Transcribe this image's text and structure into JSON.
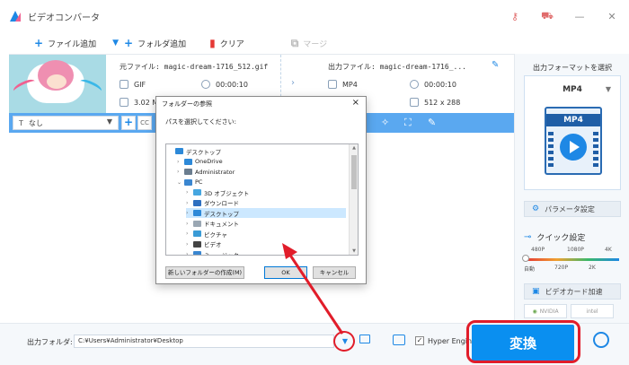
{
  "app": {
    "title": "ビデオコンバータ"
  },
  "toolbar": {
    "add_file": "ファイル追加",
    "add_folder": "フォルダ追加",
    "clear": "クリア",
    "merge": "マージ"
  },
  "file": {
    "source_name": "元ファイル: magic-dream-1716_512.gif",
    "source_format": "GIF",
    "source_duration": "00:00:10",
    "source_size": "3.02 M",
    "output_name": "出力ファイル: magic-dream-1716_...",
    "output_format": "MP4",
    "output_duration": "00:00:10",
    "output_resolution": "512 x 288"
  },
  "subtitle": {
    "select": "なし",
    "cc": "CC"
  },
  "right_panel": {
    "header": "出力フォーマットを選択",
    "format": "MP4",
    "format_icon_text": "MP4",
    "params": "パラメータ設定",
    "quick": "クイック設定",
    "ticks_top": [
      "480P",
      "1080P",
      "4K"
    ],
    "ticks_bottom": [
      "自動",
      "720P",
      "2K"
    ],
    "hw_accel": "ビデオカード加速",
    "gpu": [
      "NVIDIA",
      "intel"
    ]
  },
  "bottom": {
    "output_label": "出力フォルダ:",
    "output_path": "C:¥Users¥Administrator¥Desktop",
    "hyper_engine": "Hyper Engine",
    "convert": "変換"
  },
  "dialog": {
    "title": "フォルダーの参照",
    "prompt": "パスを選択してください:",
    "tree": [
      {
        "label": "デスクトップ",
        "level": 0,
        "exp": "",
        "color": "#2d89d8",
        "selected": false
      },
      {
        "label": "OneDrive",
        "level": 1,
        "exp": ">",
        "color": "#2d89d8",
        "selected": false
      },
      {
        "label": "Administrator",
        "level": 1,
        "exp": ">",
        "color": "#6b7d8f",
        "selected": false
      },
      {
        "label": "PC",
        "level": 1,
        "exp": "v",
        "color": "#3a86d0",
        "selected": false
      },
      {
        "label": "3D オブジェクト",
        "level": 2,
        "exp": ">",
        "color": "#46a6e0",
        "selected": false
      },
      {
        "label": "ダウンロード",
        "level": 2,
        "exp": ">",
        "color": "#2d6fc0",
        "selected": false
      },
      {
        "label": "デスクトップ",
        "level": 2,
        "exp": ">",
        "color": "#2d89d8",
        "selected": true
      },
      {
        "label": "ドキュメント",
        "level": 2,
        "exp": ">",
        "color": "#9aa7b3",
        "selected": false
      },
      {
        "label": "ピクチャ",
        "level": 2,
        "exp": ">",
        "color": "#3a9bd6",
        "selected": false
      },
      {
        "label": "ビデオ",
        "level": 2,
        "exp": ">",
        "color": "#444444",
        "selected": false
      },
      {
        "label": "ミュージック",
        "level": 2,
        "exp": ">",
        "color": "#3a86d0",
        "selected": false
      }
    ],
    "new_folder": "新しいフォルダーの作成(M)",
    "ok": "OK",
    "cancel": "キャンセル"
  },
  "colors": {
    "accent": "#1e88e5",
    "convert_bg": "#0a8ff0",
    "annotation": "#e11d2a",
    "subbar": "#5aa8f0"
  }
}
